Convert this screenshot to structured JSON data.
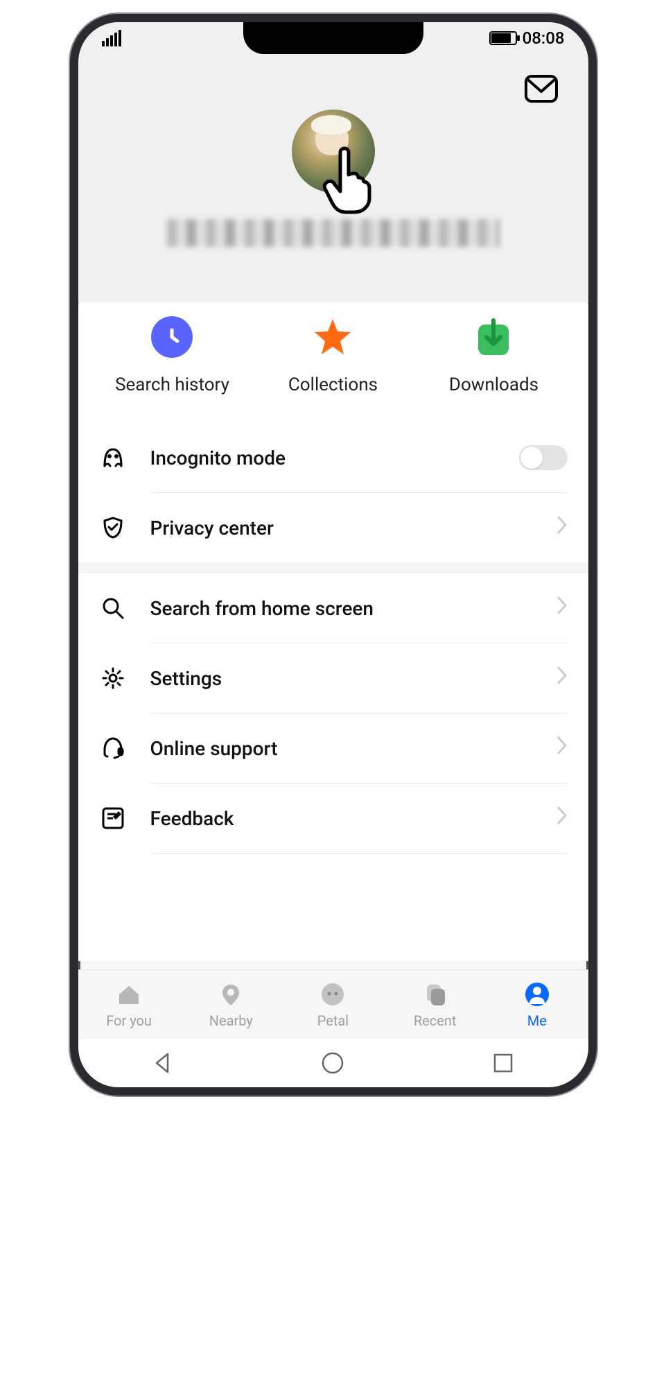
{
  "status": {
    "time": "08:08"
  },
  "quick": {
    "history": "Search history",
    "collections": "Collections",
    "downloads": "Downloads"
  },
  "list": {
    "incognito": "Incognito mode",
    "privacy": "Privacy center",
    "search_home": "Search from home screen",
    "settings": "Settings",
    "support": "Online support",
    "feedback": "Feedback"
  },
  "nav": {
    "for_you": "For you",
    "nearby": "Nearby",
    "petal": "Petal",
    "recent": "Recent",
    "me": "Me"
  }
}
